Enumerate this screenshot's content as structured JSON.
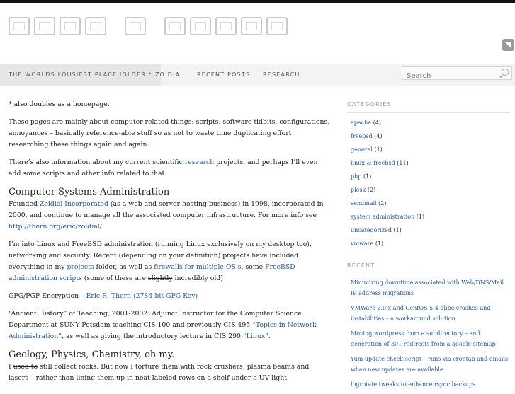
{
  "nav": {
    "items": [
      "THE WORLDS LOUSIEST PLACEHOLDER.*",
      "ZOIDIAL",
      "RECENT POSTS",
      "RESEARCH"
    ]
  },
  "search": {
    "placeholder": "Search"
  },
  "main": {
    "p1": "* also doubles as a homepage.",
    "p2": "These pages are mainly about computer related things: scripts, software tidbits, configurations, annoyances – basically reference-able stuff so as not to waste time duplicating effort researching these things again and again.",
    "p3_pre": "There’s also information about my current scientific ",
    "p3_link": "research",
    "p3_post": " projects, and perhaps I’ll even add some scripts and other info related to that.",
    "h_sysadmin": "Computer Systems Administration",
    "p4_pre": "Founded ",
    "p4_link1": "Zoidial Incorporated",
    "p4_mid": " (as a web and server hosting business) in 1998, incorporated in 2000, and continue to manage all the associated computer infrastructure.  For more info see ",
    "p4_link2": "http://thern.org/eric/zoidial/",
    "p5_a": "I’m into Linux and FreeBSD administration (running Linux exclusively on my desktop too), networking and security. Recent (depending on your definition) projects have included everything in my ",
    "p5_link1": "projects",
    "p5_b": " folder, as well as ",
    "p5_link2": "firewalls for multiple OS’s",
    "p5_c": ", some ",
    "p5_link3": "FreeBSD administration scripts",
    "p5_d": " (some of these are ",
    "p5_strike": "slightly",
    "p5_e": " incredibly old)",
    "p6_pre": "GPG/PGP Encryption – ",
    "p6_link": "Eric R. Thern (2784-bit GPG Key)",
    "p7_a": "“Ancient History” of Teaching, 2001-2002: Adjunct Instructor for the Computer Science Department at SUNY Potsdam teaching CIS 100 and previously CIS 495 ",
    "p7_link1": "“Topics in Network Administration”",
    "p7_b": ", as well as giving the introductory lecture in CIS 290 ",
    "p7_link2": "“Linux”",
    "p7_c": ".",
    "h_geo": "Geology, Physics, Chemistry, oh my.",
    "p8_a": "I ",
    "p8_strike": "used to",
    "p8_b": " still collect rocks.  But now I torture them with rock crushers, plasma beams and lasers – rather than lining them up in neat labeled rows on a shelf under a UV light."
  },
  "sidebar": {
    "categories_heading": "CATEGORIES",
    "categories": [
      {
        "name": "apache",
        "count": "(4)"
      },
      {
        "name": "freebsd",
        "count": "(4)"
      },
      {
        "name": "general",
        "count": "(1)"
      },
      {
        "name": "linux & freebsd",
        "count": "(11)"
      },
      {
        "name": "php",
        "count": "(1)"
      },
      {
        "name": "plesk",
        "count": "(2)"
      },
      {
        "name": "sendmail",
        "count": "(2)"
      },
      {
        "name": "system administration",
        "count": "(1)"
      },
      {
        "name": "uncategorized",
        "count": "(1)"
      },
      {
        "name": "vmware",
        "count": "(1)"
      }
    ],
    "recent_heading": "RECENT",
    "recent": [
      "Minimizing downtime associated with Web/DNS/Mail IP address migrations",
      "VMWare 2.0.x and CentOS 5.4 glibc crashes and instabilities – a workaround solution",
      "Moving wordpress from a subdirectory – and generation of 301 redirects from a google sitemap",
      "Yum update check script – runs via crontab and emails when new updates are available",
      "logrotate tweaks to enhance rsync backups"
    ]
  }
}
